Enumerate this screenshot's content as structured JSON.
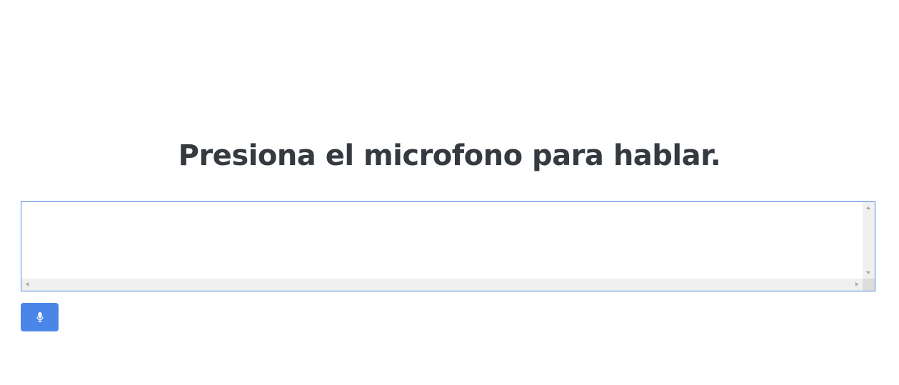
{
  "page": {
    "title": "Presiona el microfono para hablar."
  },
  "transcript": {
    "value": "",
    "placeholder": ""
  },
  "mic_button": {
    "icon": "microphone-icon"
  },
  "colors": {
    "title_text": "#343a40",
    "button_bg": "#4a86e8",
    "textarea_border": "#4f86dc",
    "scrollbar_bg": "#f0f0f0"
  }
}
